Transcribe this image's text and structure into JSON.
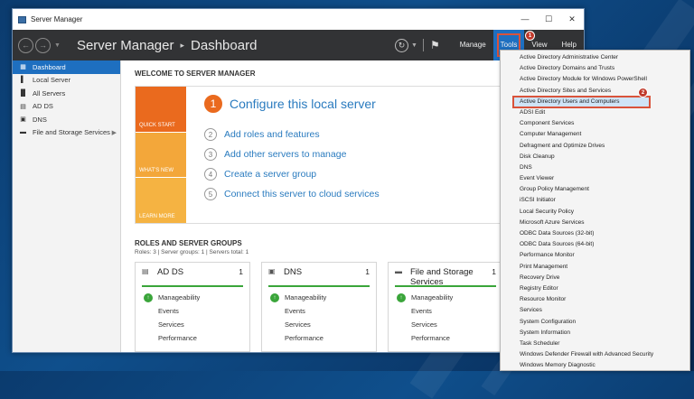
{
  "window": {
    "title": "Server Manager"
  },
  "header": {
    "breadcrumb_app": "Server Manager",
    "breadcrumb_separator": "▸",
    "breadcrumb_page": "Dashboard",
    "menu": {
      "manage": "Manage",
      "tools": "Tools",
      "view": "View",
      "help": "Help"
    }
  },
  "annotations": {
    "badge1": "1",
    "badge2": "2"
  },
  "sidebar": {
    "items": [
      {
        "label": "Dashboard",
        "icon": "dashboard-icon"
      },
      {
        "label": "Local Server",
        "icon": "server-icon"
      },
      {
        "label": "All Servers",
        "icon": "servers-icon"
      },
      {
        "label": "AD DS",
        "icon": "adds-icon"
      },
      {
        "label": "DNS",
        "icon": "dns-icon"
      },
      {
        "label": "File and Storage Services",
        "icon": "storage-icon"
      }
    ]
  },
  "welcome": {
    "title": "WELCOME TO SERVER MANAGER",
    "tiles": {
      "quick_start": "QUICK START",
      "whats_new": "WHAT'S NEW",
      "learn_more": "LEARN MORE"
    },
    "steps": [
      {
        "num": "1",
        "label": "Configure this local server"
      },
      {
        "num": "2",
        "label": "Add roles and features"
      },
      {
        "num": "3",
        "label": "Add other servers to manage"
      },
      {
        "num": "4",
        "label": "Create a server group"
      },
      {
        "num": "5",
        "label": "Connect this server to cloud services"
      }
    ]
  },
  "roles": {
    "title": "ROLES AND SERVER GROUPS",
    "summary": "Roles: 3  |  Server groups: 1  |  Servers total: 1",
    "cards": [
      {
        "name": "AD DS",
        "count": "1",
        "rows": [
          "Manageability",
          "Events",
          "Services",
          "Performance"
        ]
      },
      {
        "name": "DNS",
        "count": "1",
        "rows": [
          "Manageability",
          "Events",
          "Services",
          "Performance"
        ]
      },
      {
        "name": "File and Storage Services",
        "count": "1",
        "rows": [
          "Manageability",
          "Events",
          "Services",
          "Performance"
        ]
      }
    ]
  },
  "tools_menu": {
    "items": [
      "Active Directory Administrative Center",
      "Active Directory Domains and Trusts",
      "Active Directory Module for Windows PowerShell",
      "Active Directory Sites and Services",
      "Active Directory Users and Computers",
      "ADSI Edit",
      "Component Services",
      "Computer Management",
      "Defragment and Optimize Drives",
      "Disk Cleanup",
      "DNS",
      "Event Viewer",
      "Group Policy Management",
      "iSCSI Initiator",
      "Local Security Policy",
      "Microsoft Azure Services",
      "ODBC Data Sources (32-bit)",
      "ODBC Data Sources (64-bit)",
      "Performance Monitor",
      "Print Management",
      "Recovery Drive",
      "Registry Editor",
      "Resource Monitor",
      "Services",
      "System Configuration",
      "System Information",
      "Task Scheduler",
      "Windows Defender Firewall with Advanced Security",
      "Windows Memory Diagnostic"
    ],
    "highlighted_index": 4
  },
  "colors": {
    "accent": "#1e6fc0",
    "orange": "#ea6a1e",
    "annotation_red": "#d9533b",
    "ok_green": "#3aa53a"
  }
}
